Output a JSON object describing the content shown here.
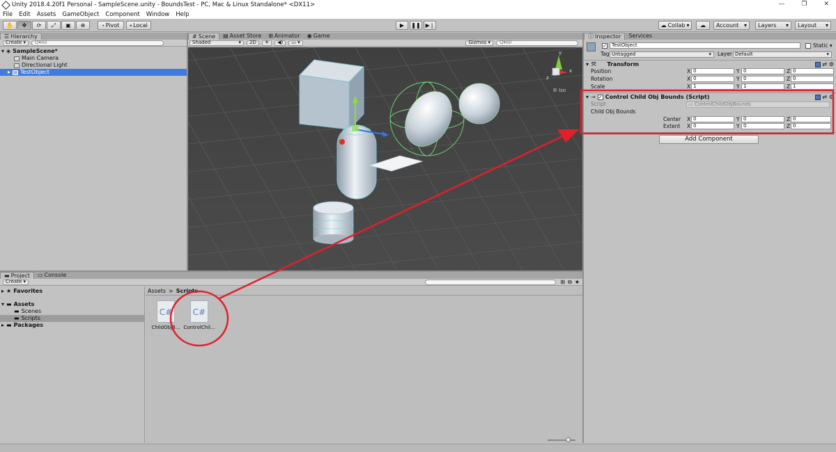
{
  "window": {
    "title": "Unity 2018.4.20f1 Personal - SampleScene.unity - BoundsTest - PC, Mac & Linux Standalone* <DX11>",
    "minimize": "—",
    "restore": "❐",
    "close": "✕"
  },
  "menu": [
    "File",
    "Edit",
    "Assets",
    "GameObject",
    "Component",
    "Window",
    "Help"
  ],
  "toolbar": {
    "pivot": "Pivot",
    "local": "Local",
    "collab": "Collab",
    "account": "Account",
    "layers": "Layers",
    "layout": "Layout"
  },
  "hierarchy": {
    "tab": "Hierarchy",
    "create": "Create",
    "search_placeholder": "Q▾All",
    "scene": "SampleScene*",
    "items": [
      "Main Camera",
      "Directional Light",
      "TestObject"
    ]
  },
  "scene_tabs": [
    "Scene",
    "Asset Store",
    "Animator",
    "Game"
  ],
  "scene_bar": {
    "shading": "Shaded",
    "mode2d": "2D",
    "gizmos": "Gizmos",
    "search": "Q▾All",
    "iso": "Iso",
    "axes": {
      "y": "y",
      "x": "x",
      "z": "z"
    }
  },
  "project": {
    "tabs": [
      "Project",
      "Console"
    ],
    "create": "Create",
    "favorites": "Favorites",
    "assets": "Assets",
    "scenes": "Scenes",
    "scripts": "Scripts",
    "packages": "Packages",
    "breadcrumb_root": "Assets",
    "breadcrumb_sep": ">",
    "breadcrumb_leaf": "Scripts",
    "files": [
      {
        "icon": "C#",
        "name": "ChildObjB..."
      },
      {
        "icon": "C#",
        "name": "ControlChil..."
      }
    ]
  },
  "inspector": {
    "tabs": [
      "Inspector",
      "Services"
    ],
    "object_name": "TestObject",
    "static": "Static",
    "tag_label": "Tag",
    "tag_value": "Untagged",
    "layer_label": "Layer",
    "layer_value": "Default",
    "transform": {
      "title": "Transform",
      "rows": [
        {
          "label": "Position",
          "x": "0",
          "y": "0",
          "z": "0"
        },
        {
          "label": "Rotation",
          "x": "0",
          "y": "0",
          "z": "0"
        },
        {
          "label": "Scale",
          "x": "1",
          "y": "1",
          "z": "1"
        }
      ]
    },
    "script_comp": {
      "title": "Control Child Obj Bounds (Script)",
      "script_label": "Script",
      "script_value": "ControlChildObjBounds",
      "bounds_label": "Child Obj Bounds",
      "rows": [
        {
          "label": "Center",
          "x": "0",
          "y": "0",
          "z": "0"
        },
        {
          "label": "Extent",
          "x": "0",
          "y": "0",
          "z": "0"
        }
      ]
    },
    "add_component": "Add Component",
    "axis_labels": {
      "x": "X",
      "y": "Y",
      "z": "Z"
    }
  },
  "colors": {
    "annotation": "#e0202a",
    "selection": "#3d7ce0",
    "scene_bg": "#464646"
  }
}
